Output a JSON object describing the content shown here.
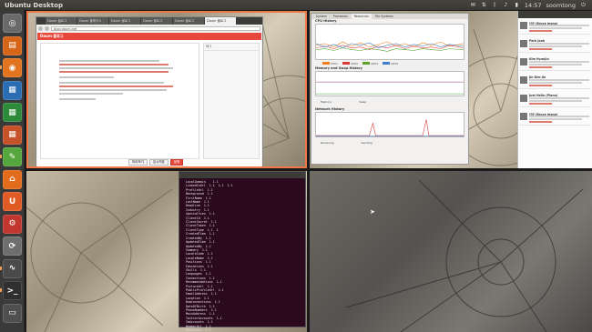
{
  "top_panel": {
    "title": "Ubuntu Desktop",
    "clock": "14:57",
    "user": "soomtong",
    "tray_icons": [
      "mail-icon",
      "network-icon",
      "bluetooth-icon",
      "volume-icon",
      "power-icon",
      "session-icon"
    ]
  },
  "launcher": {
    "items": [
      {
        "name": "dash-home",
        "color": "#6a6a6a",
        "glyph": "◎"
      },
      {
        "name": "files",
        "color": "#d6651a",
        "glyph": "▤"
      },
      {
        "name": "firefox",
        "color": "#e2731f",
        "glyph": "◉"
      },
      {
        "name": "writer",
        "color": "#2b6db3",
        "glyph": "▦"
      },
      {
        "name": "calc",
        "color": "#2d8a3a",
        "glyph": "▦"
      },
      {
        "name": "impress",
        "color": "#c6522a",
        "glyph": "▦"
      },
      {
        "name": "text-editor",
        "color": "#55a63c",
        "glyph": "✎"
      },
      {
        "name": "software-center",
        "color": "#e26b1c",
        "glyph": "⌂"
      },
      {
        "name": "ubuntu-one",
        "color": "#e05a24",
        "glyph": "U"
      },
      {
        "name": "system-settings",
        "color": "#c13730",
        "glyph": "⚙"
      },
      {
        "name": "update-manager",
        "color": "#6e6e6e",
        "glyph": "⟳"
      },
      {
        "name": "system-monitor",
        "color": "#4a4a4a",
        "glyph": "∿"
      },
      {
        "name": "terminal",
        "color": "#2f2f2f",
        "glyph": ">_"
      },
      {
        "name": "workspace-switcher",
        "color": "#4f4f4f",
        "glyph": "▭"
      }
    ]
  },
  "browser": {
    "tabs": [
      "Daum 블로그",
      "Daum 플레이스",
      "Daum 블로그",
      "Daum 블로그",
      "Daum 블로그",
      "Daum 블로그"
    ],
    "url": "blog.daum.net",
    "header": "Daum 블로그",
    "sidebar_title": "태그",
    "footer_buttons": [
      "미리보기",
      "임시저장",
      "발행"
    ]
  },
  "sysmon": {
    "tabs": [
      "System",
      "Processes",
      "Resources",
      "File Systems"
    ],
    "sections": [
      "CPU History",
      "Memory and Swap History",
      "Network History"
    ],
    "cpu_legend": [
      {
        "label": "CPU1",
        "color": "#ef7f1a"
      },
      {
        "label": "CPU2",
        "color": "#d93a3a"
      },
      {
        "label": "CPU3",
        "color": "#5aa52c"
      },
      {
        "label": "CPU4",
        "color": "#3b7fc4"
      }
    ],
    "memory_labels": [
      "Memory",
      "Swap"
    ],
    "network_labels": [
      "Receiving",
      "Sending"
    ]
  },
  "terminal": {
    "lines": [
      "  LocalDomain    1.1",
      "  LinkedInUrl  1.1  1.1  1.1",
      "  ProfileUrl  1.1",
      "  Background  1.1",
      "  FirstName  1.1",
      "  LastName  1.1",
      "  Headline  1.1",
      "  Industry  1.1",
      "  Specialties  1.1",
      "  ClientId  1.1",
      "  ClientSecret  1.1",
      "  ClientToken  1.1",
      "  ClientType  1.1  1",
      "  CreatedTime  1.1",
      "  CreatedBy  1.1",
      "  UpdatedTime  1.1",
      "  UpdatedBy  1.1",
      "  Summary  1.1",
      "  LocaleCode  1.1",
      "  LocaleName  1.1",
      "  Positions  1.1",
      "  Educations  1.1",
      "  Skills  1.1",
      "  Languages  1.1",
      "  Connections  1.1",
      "  Recommendations  1.1",
      "  PictureUrl  1.1",
      "  PublicProfileUrl  1.1",
      "  EmailAddress  1.1",
      "  Location  1.1",
      "  NumConnections  1.1",
      "  DateOfBirth  1.1",
      "  PhoneNumbers  1.1",
      "  MainAddress  1.1",
      "  TwitterAccounts  1.1",
      "  ImAccounts  1.1",
      "  MemberUrl  1.1",
      "  Interests  1.1",
      "> "
    ]
  },
  "social": {
    "posts": [
      {
        "name": "남궁 (Bruce Jeong)"
      },
      {
        "name": "Park Jooh"
      },
      {
        "name": "Kim Hyunjin"
      },
      {
        "name": "Jin Kim Jin"
      },
      {
        "name": "Just Hello (Piano)"
      },
      {
        "name": "남궁 (Bruce Jeong)"
      }
    ]
  }
}
